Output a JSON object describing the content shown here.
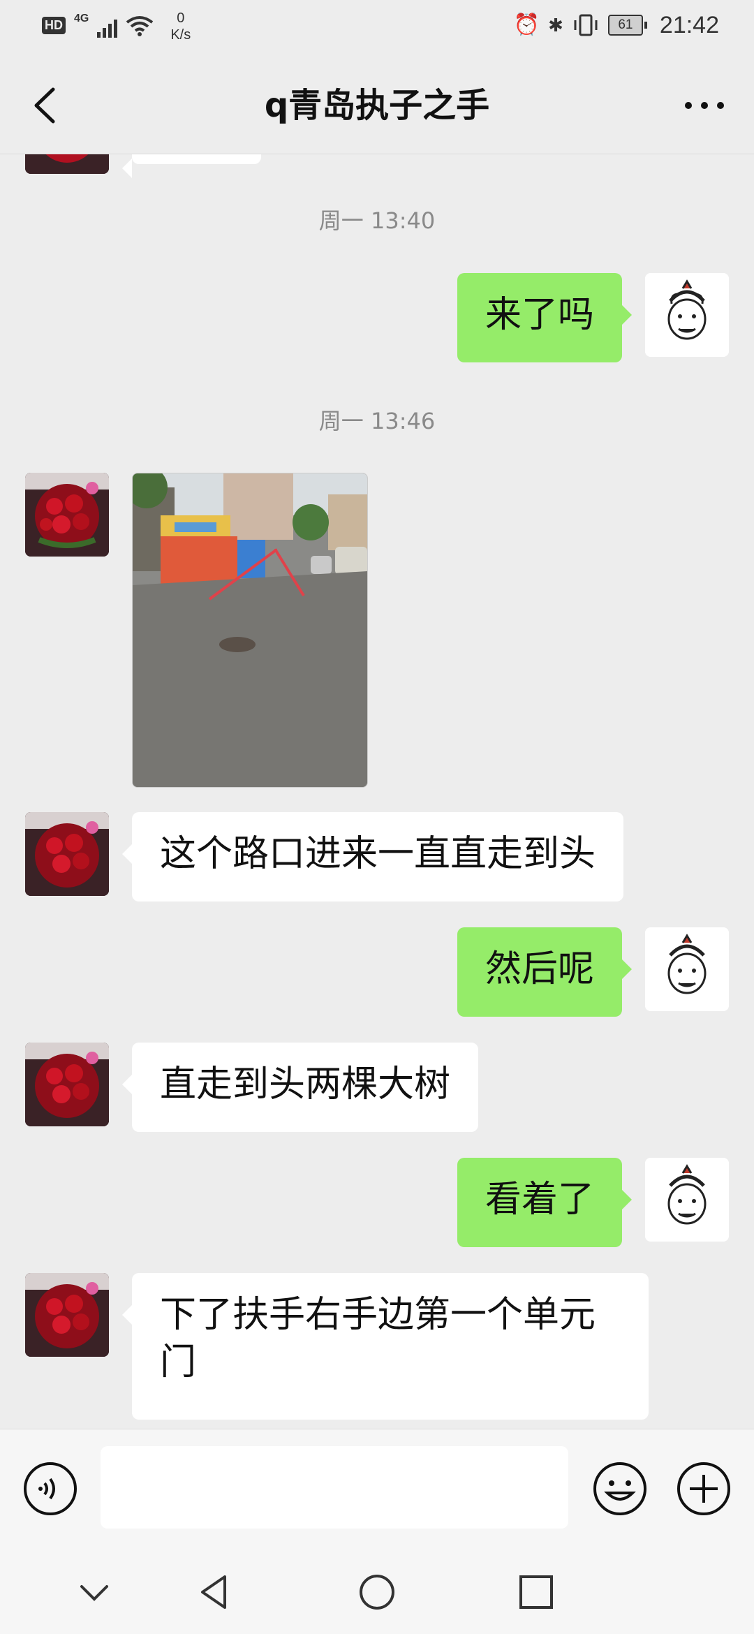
{
  "status_bar": {
    "hd": "HD",
    "network": "4G",
    "speed_value": "0",
    "speed_unit": "K/s",
    "battery": "61",
    "time": "21:42"
  },
  "header": {
    "title": "q青岛执子之手"
  },
  "messages": [
    {
      "id": "ts1",
      "type": "timestamp",
      "text": "周一 13:40"
    },
    {
      "id": "m1",
      "type": "text",
      "side": "right",
      "text": "来了吗"
    },
    {
      "id": "ts2",
      "type": "timestamp",
      "text": "周一 13:46"
    },
    {
      "id": "m2",
      "type": "image",
      "side": "left",
      "description": "street photo with red arrow"
    },
    {
      "id": "m3",
      "type": "text",
      "side": "left",
      "text": "这个路口进来一直直走到头"
    },
    {
      "id": "m4",
      "type": "text",
      "side": "right",
      "text": "然后呢"
    },
    {
      "id": "m5",
      "type": "text",
      "side": "left",
      "text": "直走到头两棵大树"
    },
    {
      "id": "m6",
      "type": "text",
      "side": "right",
      "text": "看着了"
    },
    {
      "id": "m7",
      "type": "text",
      "side": "left",
      "text": "下了扶手右手边第一个单元门"
    }
  ],
  "input": {
    "value": "",
    "placeholder": ""
  },
  "icons": {
    "back": "chevron-left-icon",
    "more": "more-dots-icon",
    "voice": "voice-icon",
    "emoji": "emoji-icon",
    "plus": "plus-icon",
    "nav_down": "chevron-down-icon",
    "nav_back": "triangle-back-icon",
    "nav_home": "circle-home-icon",
    "nav_recent": "square-recent-icon"
  },
  "colors": {
    "background": "#ededed",
    "sent_bubble": "#95ec69",
    "received_bubble": "#ffffff",
    "timestamp": "#8a8a8a"
  }
}
